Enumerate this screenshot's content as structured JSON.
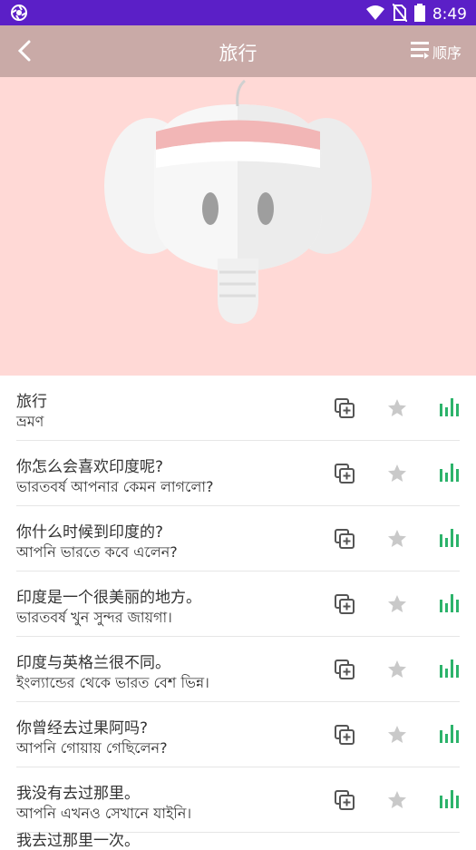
{
  "status_bar": {
    "time": "8:49",
    "bg_color": "#5b1fc7",
    "icons": [
      "app-icon",
      "wifi-icon",
      "no-sim-icon",
      "battery-icon"
    ]
  },
  "app_bar": {
    "title": "旅行",
    "order_label": "顺序",
    "bg_color": "#c9aaa7"
  },
  "hero": {
    "bg_color": "#ffd9d6",
    "image": "elephant-icon"
  },
  "phrases": [
    {
      "zh": "旅行",
      "bn": "ভ্রমণ"
    },
    {
      "zh": "你怎么会喜欢印度呢?",
      "bn": "ভারতবর্ষ আপনার কেমন লাগলো?"
    },
    {
      "zh": "你什么时候到印度的?",
      "bn": "আপনি ভারতে কবে এলেন?"
    },
    {
      "zh": "印度是一个很美丽的地方。",
      "bn": "ভারতবর্ষ খুন সুন্দর জায়গা।"
    },
    {
      "zh": "印度与英格兰很不同。",
      "bn": "ইংল্যান্ডের থেকে ভারত বেশ ভিন্ন।"
    },
    {
      "zh": "你曾经去过果阿吗?",
      "bn": "আপনি গোয়ায় গেছিলেন?"
    },
    {
      "zh": "我没有去过那里。",
      "bn": "আপনি এখনও সেখানে যাইনি।"
    }
  ],
  "partial_row": {
    "zh": "我去过那里一次。"
  },
  "accent_green": "#2db36b"
}
